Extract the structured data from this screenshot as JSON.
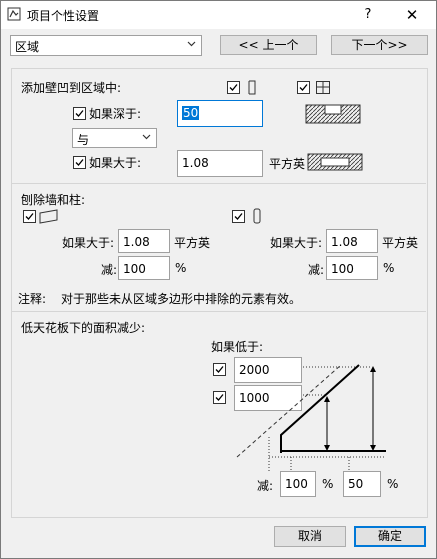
{
  "window": {
    "title": "项目个性设置",
    "help_label": "?",
    "close_label": "✕"
  },
  "top": {
    "zone_select": "区域",
    "prev_button": "<< 上一个",
    "next_button": "下一个>>"
  },
  "recess": {
    "heading": "添加壁凹到区域中:",
    "if_deeper_label": "如果深于:",
    "if_deeper_value": "50",
    "operator_select": "与",
    "if_larger_label": "如果大于:",
    "if_larger_value": "1.08",
    "unit": "平方英"
  },
  "walls_columns": {
    "heading": "刨除墙和柱:",
    "left": {
      "if_larger_label": "如果大于:",
      "if_larger_value": "1.08",
      "unit": "平方英",
      "reduce_label": "减:",
      "reduce_value": "100",
      "percent": "%"
    },
    "right": {
      "if_larger_label": "如果大于:",
      "if_larger_value": "1.08",
      "unit": "平方英",
      "reduce_label": "减:",
      "reduce_value": "100",
      "percent": "%"
    }
  },
  "note": {
    "label": "注释:",
    "text": "对于那些未从区域多边形中排除的元素有效。"
  },
  "low_ceiling": {
    "heading": "低天花板下的面积减少:",
    "if_lower_label": "如果低于:",
    "height1": "2000",
    "height2": "1000",
    "reduce_label": "减:",
    "reduce1": "100",
    "reduce2": "50",
    "percent": "%"
  },
  "footer": {
    "cancel_button": "取消",
    "ok_button": "确定"
  },
  "colors": {
    "accent": "#0078d7",
    "dialog_bg": "#f0f0f0"
  }
}
